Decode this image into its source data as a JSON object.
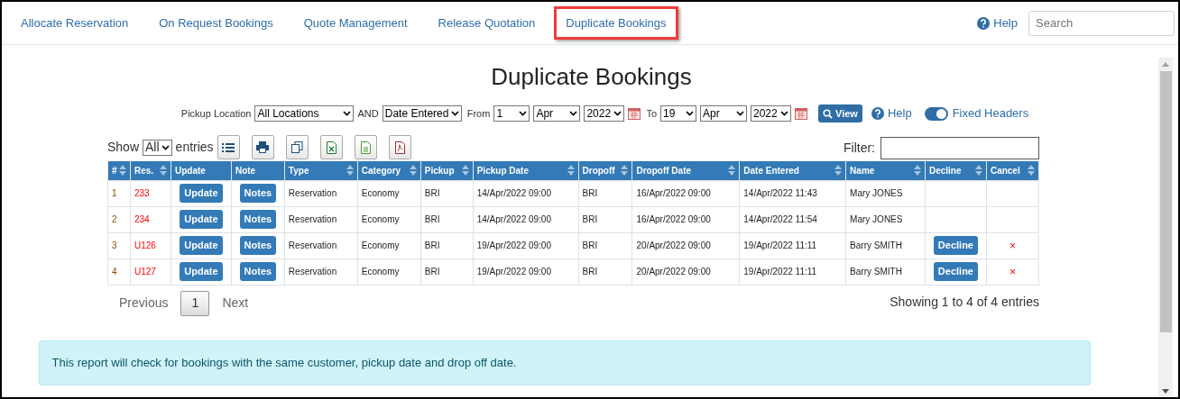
{
  "nav": {
    "tabs": [
      {
        "label": "Allocate Reservation",
        "selected": false
      },
      {
        "label": "On Request Bookings",
        "selected": false
      },
      {
        "label": "Quote Management",
        "selected": false
      },
      {
        "label": "Release Quotation",
        "selected": false
      },
      {
        "label": "Duplicate Bookings",
        "selected": true
      }
    ],
    "help": "Help",
    "search": {
      "placeholder": "Search"
    }
  },
  "title": "Duplicate Bookings",
  "filters": {
    "pickup_label": "Pickup Location",
    "pickup_value": "All Locations",
    "and_label": "AND",
    "date_type": "Date Entered",
    "from_label": "From",
    "from": [
      "1",
      "Apr",
      "2022"
    ],
    "to_label": "To",
    "to": [
      "19",
      "Apr",
      "2022"
    ],
    "view_button": "View",
    "help": "Help",
    "fixed_headers": {
      "label": "Fixed Headers",
      "on": true
    }
  },
  "table_controls": {
    "show_label": "Show",
    "show_value": "All",
    "entries_label": "entries",
    "filter_label": "Filter:"
  },
  "table": {
    "columns": [
      {
        "label": "#",
        "sortable": true
      },
      {
        "label": "Res.",
        "sortable": true
      },
      {
        "label": "Update",
        "sortable": false
      },
      {
        "label": "Note",
        "sortable": false
      },
      {
        "label": "Type",
        "sortable": true
      },
      {
        "label": "Category",
        "sortable": true
      },
      {
        "label": "Pickup",
        "sortable": true
      },
      {
        "label": "Pickup Date",
        "sortable": true
      },
      {
        "label": "Dropoff",
        "sortable": true
      },
      {
        "label": "Dropoff Date",
        "sortable": true
      },
      {
        "label": "Date Entered",
        "sortable": true
      },
      {
        "label": "Name",
        "sortable": true
      },
      {
        "label": "Decline",
        "sortable": true
      },
      {
        "label": "Cancel",
        "sortable": true
      }
    ],
    "rows": [
      {
        "num": "1",
        "res": "233",
        "update": "Update",
        "note": "Notes",
        "type": "Reservation",
        "category": "Economy",
        "pickup": "BRI",
        "pickup_date": "14/Apr/2022 09:00",
        "dropoff": "BRI",
        "dropoff_date": "16/Apr/2022 09:00",
        "date_entered": "14/Apr/2022 11:43",
        "name": "Mary JONES"
      },
      {
        "num": "2",
        "res": "234",
        "update": "Update",
        "note": "Notes",
        "type": "Reservation",
        "category": "Economy",
        "pickup": "BRI",
        "pickup_date": "14/Apr/2022 09:00",
        "dropoff": "BRI",
        "dropoff_date": "16/Apr/2022 09:00",
        "date_entered": "14/Apr/2022 11:54",
        "name": "Mary JONES"
      },
      {
        "num": "3",
        "res": "U126",
        "update": "Update",
        "note": "Notes",
        "type": "Reservation",
        "category": "Economy",
        "pickup": "BRI",
        "pickup_date": "19/Apr/2022 09:00",
        "dropoff": "BRI",
        "dropoff_date": "20/Apr/2022 09:00",
        "date_entered": "19/Apr/2022 11:11",
        "name": "Barry SMITH",
        "decline": "Decline",
        "cancel": "×"
      },
      {
        "num": "4",
        "res": "U127",
        "update": "Update",
        "note": "Notes",
        "type": "Reservation",
        "category": "Economy",
        "pickup": "BRI",
        "pickup_date": "19/Apr/2022 09:00",
        "dropoff": "BRI",
        "dropoff_date": "20/Apr/2022 09:00",
        "date_entered": "19/Apr/2022 11:11",
        "name": "Barry SMITH",
        "decline": "Decline",
        "cancel": "×"
      }
    ]
  },
  "pagination": {
    "previous": "Previous",
    "pages": [
      {
        "label": "1",
        "selected": true
      }
    ],
    "next": "Next",
    "summary": "Showing 1 to 4 of 4 entries"
  },
  "info": "This report will check for bookings with the same customer, pickup date and drop off date."
}
